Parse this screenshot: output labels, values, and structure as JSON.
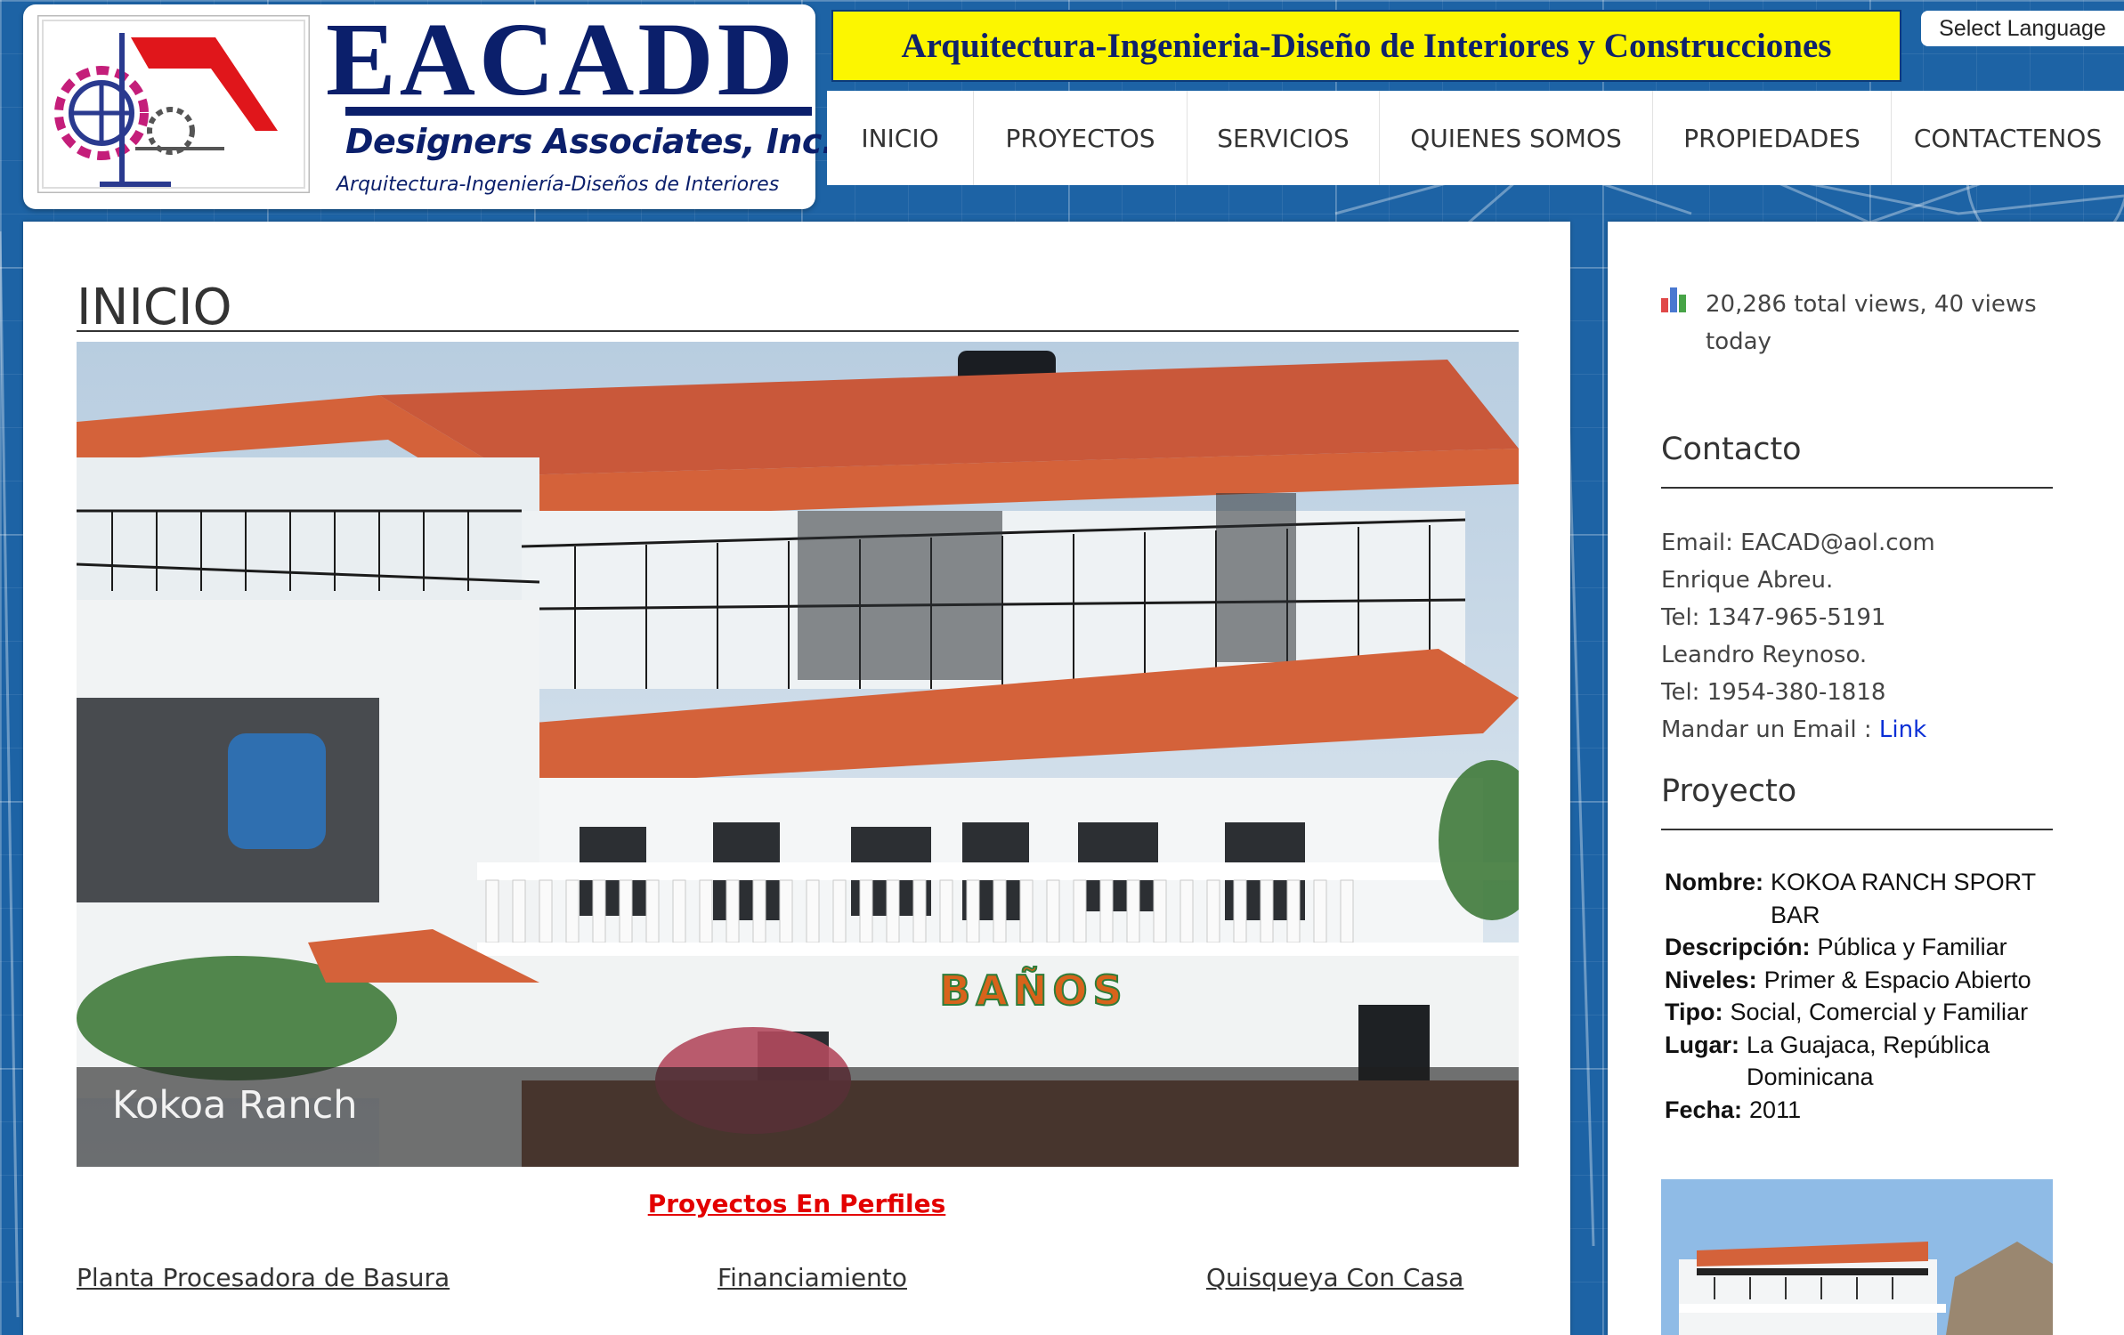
{
  "brand": {
    "name": "EACADD",
    "subtitle": "Designers Associates, Inc.",
    "tagline": "Arquitectura-Ingeniería-Diseños de Interiores"
  },
  "banner": {
    "text": "Arquitectura-Ingenieria-Diseño de Interiores y Construcciones"
  },
  "language": {
    "label": "Select Language"
  },
  "nav": {
    "items": [
      {
        "label": "INICIO"
      },
      {
        "label": "PROYECTOS"
      },
      {
        "label": "SERVICIOS"
      },
      {
        "label": "QUIENES SOMOS"
      },
      {
        "label": "PROPIEDADES"
      },
      {
        "label": "CONTACTENOS"
      }
    ]
  },
  "main": {
    "title": "INICIO",
    "slide": {
      "caption": "Kokoa Ranch",
      "sign_text": "BAÑOS"
    },
    "profiles_link": "Proyectos En Perfiles",
    "bottom_links": [
      {
        "label": "Planta Procesadora de Basura"
      },
      {
        "label": "Financiamiento"
      },
      {
        "label": "Quisqueya Con Casa"
      }
    ]
  },
  "sidebar": {
    "views": {
      "text": "20,286 total views, 40 views today",
      "icon": "bar-chart-icon"
    },
    "contact": {
      "title": "Contacto",
      "email_line": "Email: EACAD@aol.com",
      "person1": "Enrique Abreu.",
      "tel1": "Tel: 1347-965-5191",
      "person2": "Leandro Reynoso.",
      "tel2": "Tel: 1954-380-1818",
      "send_email_label": "Mandar un Email : ",
      "send_email_link": "Link"
    },
    "project": {
      "title": "Proyecto",
      "rows": [
        {
          "key": "Nombre:",
          "value": "KOKOA RANCH SPORT BAR"
        },
        {
          "key": "Descripción:",
          "value": "Pública y Familiar"
        },
        {
          "key": "Niveles:",
          "value": "Primer & Espacio Abierto"
        },
        {
          "key": "Tipo:",
          "value": "Social, Comercial y Familiar"
        },
        {
          "key": "Lugar:",
          "value": "La Guajaca, República Dominicana"
        },
        {
          "key": "Fecha:",
          "value": "2011"
        }
      ]
    }
  },
  "colors": {
    "background_blue": "#1d63a5",
    "banner_yellow": "#fcf600",
    "brand_navy": "#0b1f6b",
    "link_red": "#e30000",
    "link_blue": "#0a2fd6",
    "roof_terracotta": "#d4623a"
  }
}
